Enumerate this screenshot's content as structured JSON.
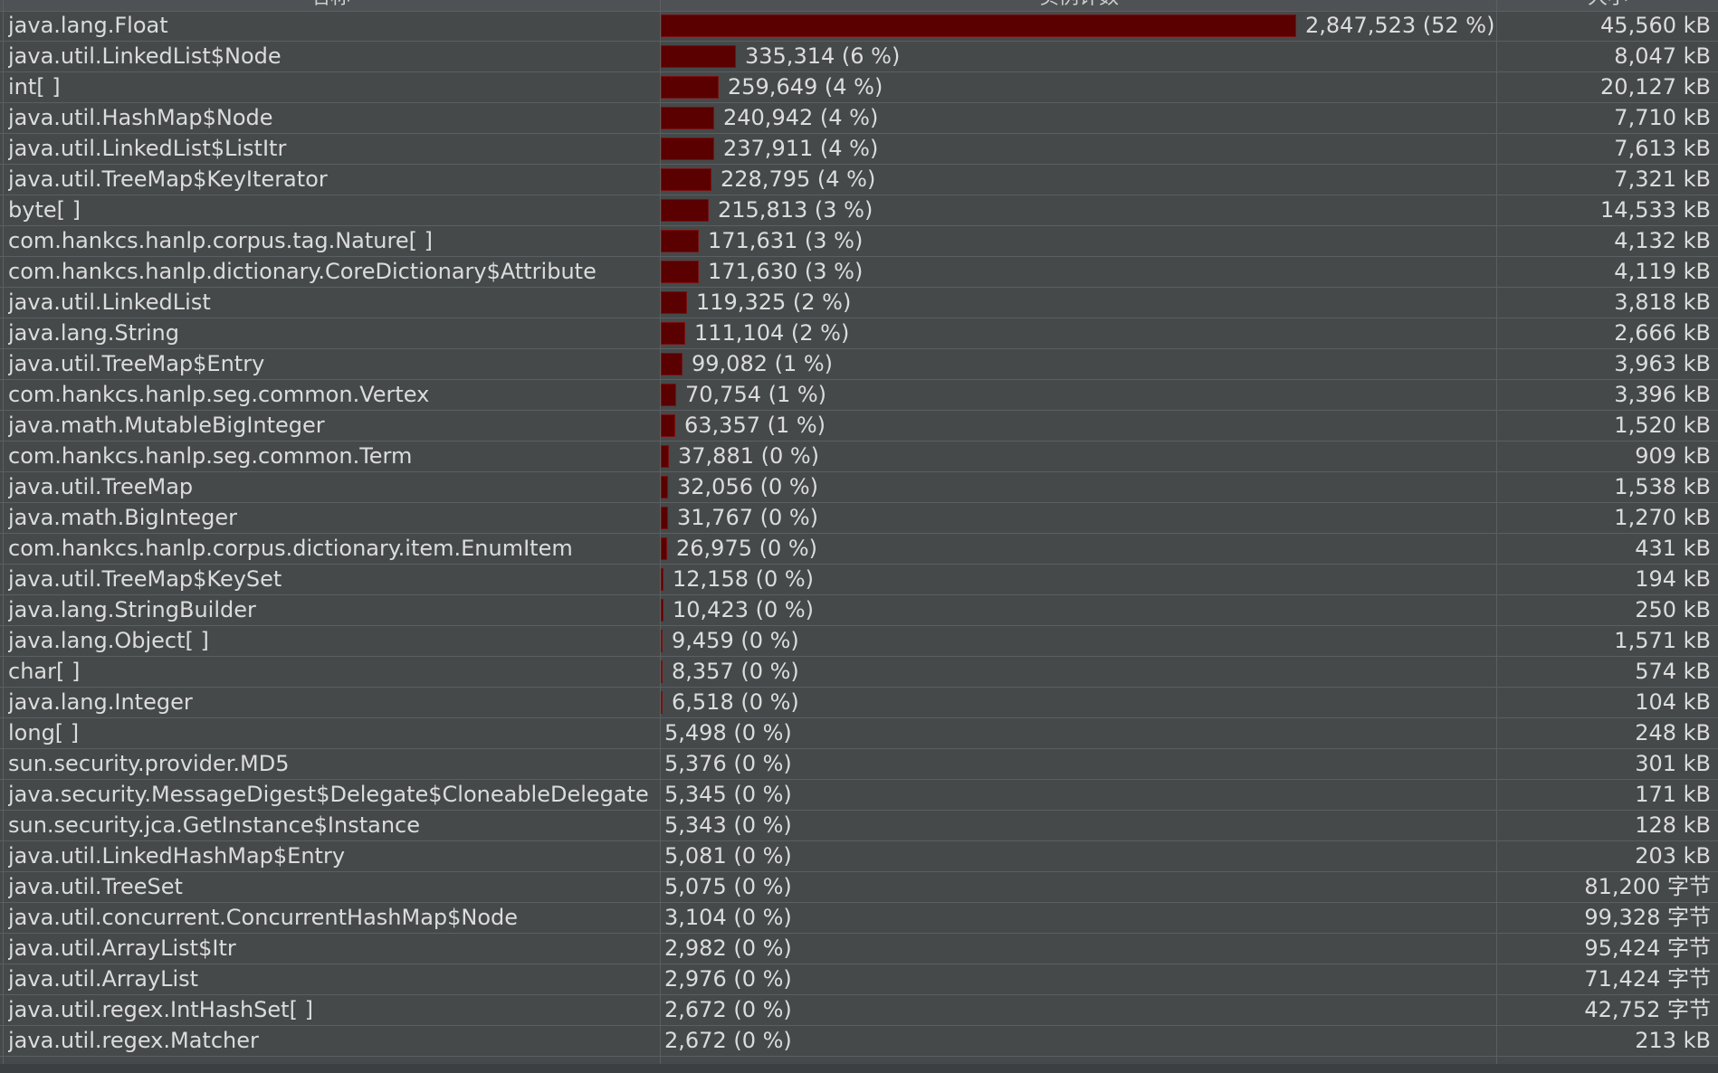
{
  "columns": {
    "name": "名称",
    "count": "实例计数",
    "size": "大小"
  },
  "rows": [
    {
      "name": "java.lang.Float",
      "count": "2,847,523 (52 %)",
      "fraction": 0.52,
      "size": "45,560 kB"
    },
    {
      "name": "java.util.LinkedList$Node",
      "count": "335,314 (6 %)",
      "fraction": 0.0612,
      "size": "8,047 kB"
    },
    {
      "name": "int[ ]",
      "count": "259,649 (4 %)",
      "fraction": 0.0474,
      "size": "20,127 kB"
    },
    {
      "name": "java.util.HashMap$Node",
      "count": "240,942 (4 %)",
      "fraction": 0.044,
      "size": "7,710 kB"
    },
    {
      "name": "java.util.LinkedList$ListItr",
      "count": "237,911 (4 %)",
      "fraction": 0.0434,
      "size": "7,613 kB"
    },
    {
      "name": "java.util.TreeMap$KeyIterator",
      "count": "228,795 (4 %)",
      "fraction": 0.0418,
      "size": "7,321 kB"
    },
    {
      "name": "byte[ ]",
      "count": "215,813 (3 %)",
      "fraction": 0.0394,
      "size": "14,533 kB"
    },
    {
      "name": "com.hankcs.hanlp.corpus.tag.Nature[ ]",
      "count": "171,631 (3 %)",
      "fraction": 0.0313,
      "size": "4,132 kB"
    },
    {
      "name": "com.hankcs.hanlp.dictionary.CoreDictionary$Attribute",
      "count": "171,630 (3 %)",
      "fraction": 0.0313,
      "size": "4,119 kB"
    },
    {
      "name": "java.util.LinkedList",
      "count": "119,325 (2 %)",
      "fraction": 0.0218,
      "size": "3,818 kB"
    },
    {
      "name": "java.lang.String",
      "count": "111,104 (2 %)",
      "fraction": 0.0203,
      "size": "2,666 kB"
    },
    {
      "name": "java.util.TreeMap$Entry",
      "count": "99,082 (1 %)",
      "fraction": 0.0181,
      "size": "3,963 kB"
    },
    {
      "name": "com.hankcs.hanlp.seg.common.Vertex",
      "count": "70,754 (1 %)",
      "fraction": 0.0129,
      "size": "3,396 kB"
    },
    {
      "name": "java.math.MutableBigInteger",
      "count": "63,357 (1 %)",
      "fraction": 0.0116,
      "size": "1,520 kB"
    },
    {
      "name": "com.hankcs.hanlp.seg.common.Term",
      "count": "37,881 (0 %)",
      "fraction": 0.0069,
      "size": "909 kB"
    },
    {
      "name": "java.util.TreeMap",
      "count": "32,056 (0 %)",
      "fraction": 0.0059,
      "size": "1,538 kB"
    },
    {
      "name": "java.math.BigInteger",
      "count": "31,767 (0 %)",
      "fraction": 0.0058,
      "size": "1,270 kB"
    },
    {
      "name": "com.hankcs.hanlp.corpus.dictionary.item.EnumItem",
      "count": "26,975 (0 %)",
      "fraction": 0.0049,
      "size": "431 kB"
    },
    {
      "name": "java.util.TreeMap$KeySet",
      "count": "12,158 (0 %)",
      "fraction": 0.0022,
      "size": "194 kB"
    },
    {
      "name": "java.lang.StringBuilder",
      "count": "10,423 (0 %)",
      "fraction": 0.0019,
      "size": "250 kB"
    },
    {
      "name": "java.lang.Object[ ]",
      "count": "9,459 (0 %)",
      "fraction": 0.0017,
      "size": "1,571 kB"
    },
    {
      "name": "char[ ]",
      "count": "8,357 (0 %)",
      "fraction": 0.0015,
      "size": "574 kB"
    },
    {
      "name": "java.lang.Integer",
      "count": "6,518 (0 %)",
      "fraction": 0.0012,
      "size": "104 kB"
    },
    {
      "name": "long[ ]",
      "count": "5,498 (0 %)",
      "fraction": 0.001,
      "size": "248 kB"
    },
    {
      "name": "sun.security.provider.MD5",
      "count": "5,376 (0 %)",
      "fraction": 0.001,
      "size": "301 kB"
    },
    {
      "name": "java.security.MessageDigest$Delegate$CloneableDelegate",
      "count": "5,345 (0 %)",
      "fraction": 0.001,
      "size": "171 kB"
    },
    {
      "name": "sun.security.jca.GetInstance$Instance",
      "count": "5,343 (0 %)",
      "fraction": 0.001,
      "size": "128 kB"
    },
    {
      "name": "java.util.LinkedHashMap$Entry",
      "count": "5,081 (0 %)",
      "fraction": 0.0009,
      "size": "203 kB"
    },
    {
      "name": "java.util.TreeSet",
      "count": "5,075 (0 %)",
      "fraction": 0.0009,
      "size": "81,200 字节"
    },
    {
      "name": "java.util.concurrent.ConcurrentHashMap$Node",
      "count": "3,104 (0 %)",
      "fraction": 0.0006,
      "size": "99,328 字节"
    },
    {
      "name": "java.util.ArrayList$Itr",
      "count": "2,982 (0 %)",
      "fraction": 0.0005,
      "size": "95,424 字节"
    },
    {
      "name": "java.util.ArrayList",
      "count": "2,976 (0 %)",
      "fraction": 0.0005,
      "size": "71,424 字节"
    },
    {
      "name": "java.util.regex.IntHashSet[ ]",
      "count": "2,672 (0 %)",
      "fraction": 0.0005,
      "size": "42,752 字节"
    },
    {
      "name": "java.util.regex.Matcher",
      "count": "2,672 (0 %)",
      "fraction": 0.0005,
      "size": "213 kB"
    }
  ],
  "colors": {
    "background": "#45494a",
    "bar_fill": "#5a0000",
    "text": "#dcdcdc",
    "grid": "#5b5f61"
  }
}
